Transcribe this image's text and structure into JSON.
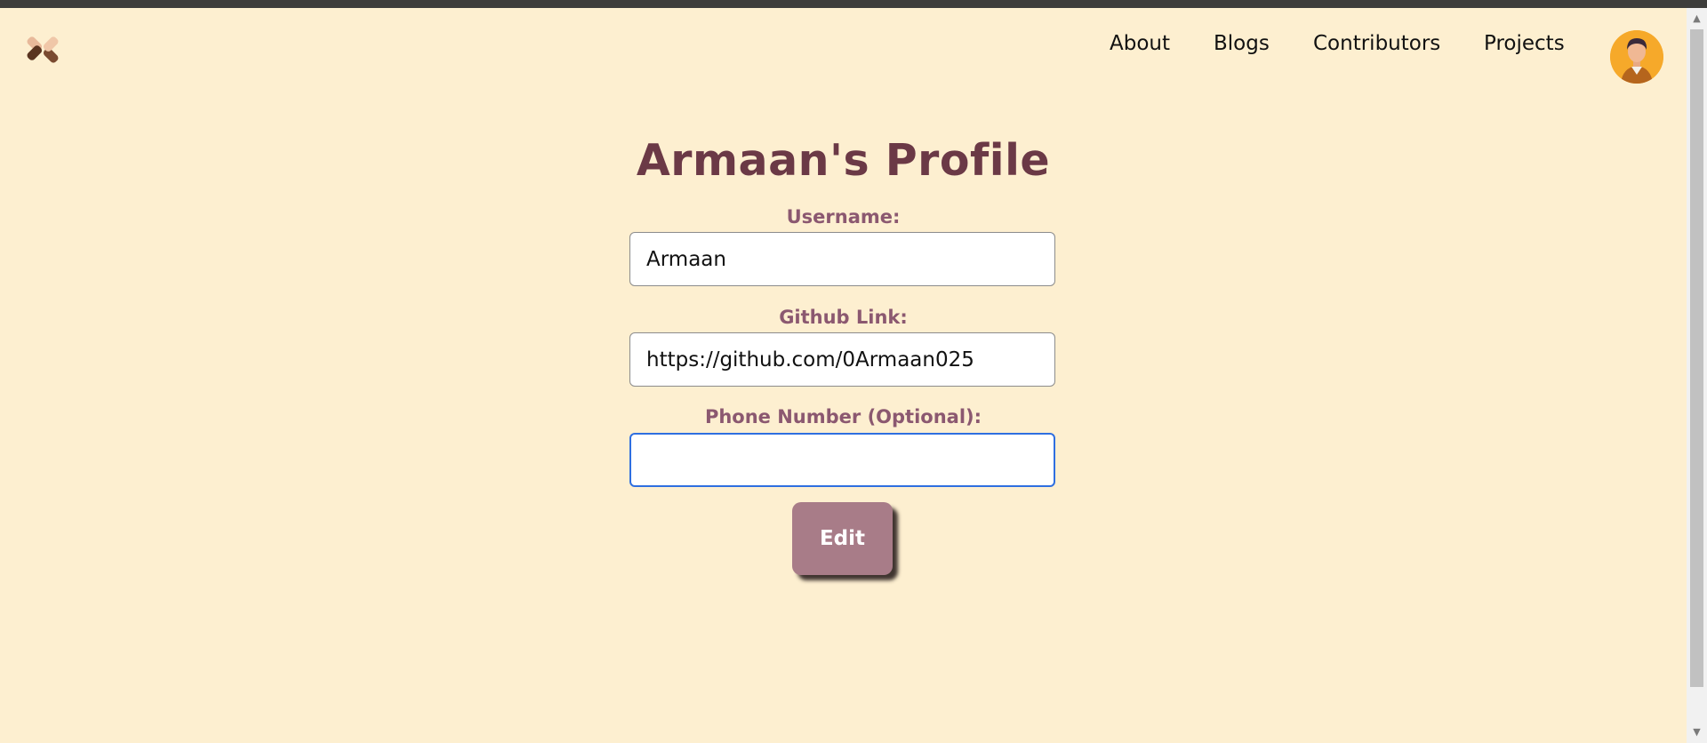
{
  "nav": {
    "about": "About",
    "blogs": "Blogs",
    "contributors": "Contributors",
    "projects": "Projects",
    "logo_icon": "helping-hands-icon",
    "avatar_icon": "user-avatar-icon"
  },
  "profile": {
    "title": "Armaan's Profile",
    "username_label": "Username:",
    "username_value": "Armaan",
    "github_label": "Github Link:",
    "github_value": "https://github.com/0Armaan025",
    "phone_label": "Phone Number (Optional):",
    "phone_value": "",
    "edit_button": "Edit"
  },
  "colors": {
    "background": "#fdefd0",
    "title": "#6b3946",
    "label": "#8b5870",
    "button": "#a87c88",
    "focus_border": "#2f6fe0"
  }
}
